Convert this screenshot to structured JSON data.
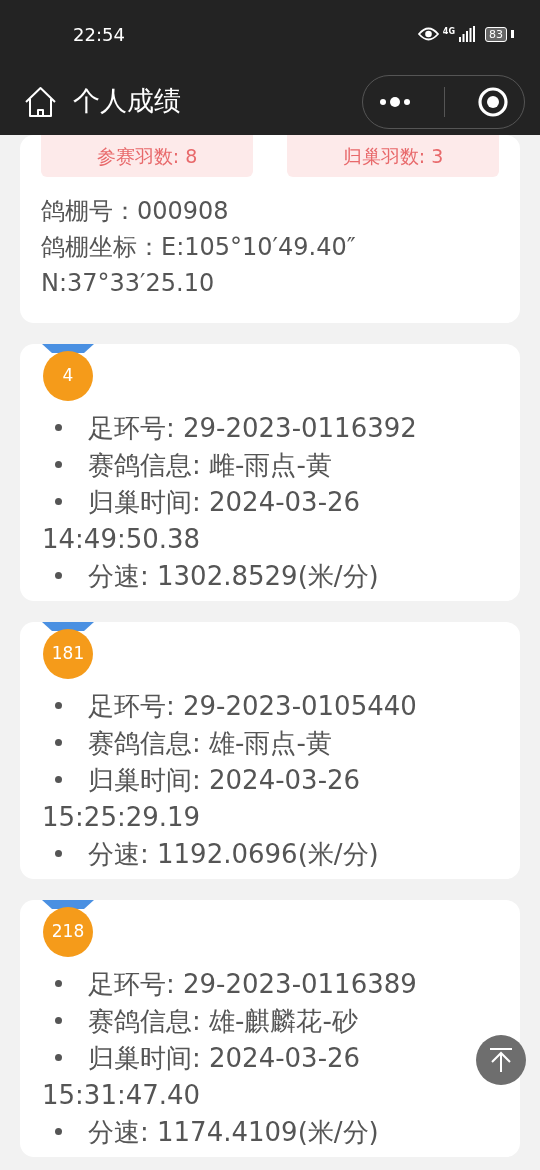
{
  "status_bar": {
    "time": "22:54",
    "network": "4G",
    "battery": "83"
  },
  "nav": {
    "title": "个人成绩"
  },
  "summary": {
    "stats": [
      "参赛羽数: 8",
      "归巢羽数: 3"
    ],
    "lines": [
      "鸽棚号：000908",
      "鸽棚坐标：E:105°10′49.40″ N:37°33′25.10"
    ]
  },
  "records": [
    {
      "rank": "4",
      "lines": [
        "足环号: 29-2023-0116392",
        "赛鸽信息: 雌-雨点-黄",
        {
          "text": "归巢时间: 2024-03-26",
          "wrap": "14:49:50.38"
        },
        "分速: 1302.8529(米/分)"
      ]
    },
    {
      "rank": "181",
      "lines": [
        "足环号: 29-2023-0105440",
        "赛鸽信息: 雄-雨点-黄",
        {
          "text": "归巢时间: 2024-03-26",
          "wrap": "15:25:29.19"
        },
        "分速: 1192.0696(米/分)"
      ]
    },
    {
      "rank": "218",
      "lines": [
        "足环号: 29-2023-0116389",
        "赛鸽信息: 雄-麒麟花-砂",
        {
          "text": "归巢时间: 2024-03-26",
          "wrap": "15:31:47.40"
        },
        "分速: 1174.4109(米/分)"
      ]
    }
  ]
}
